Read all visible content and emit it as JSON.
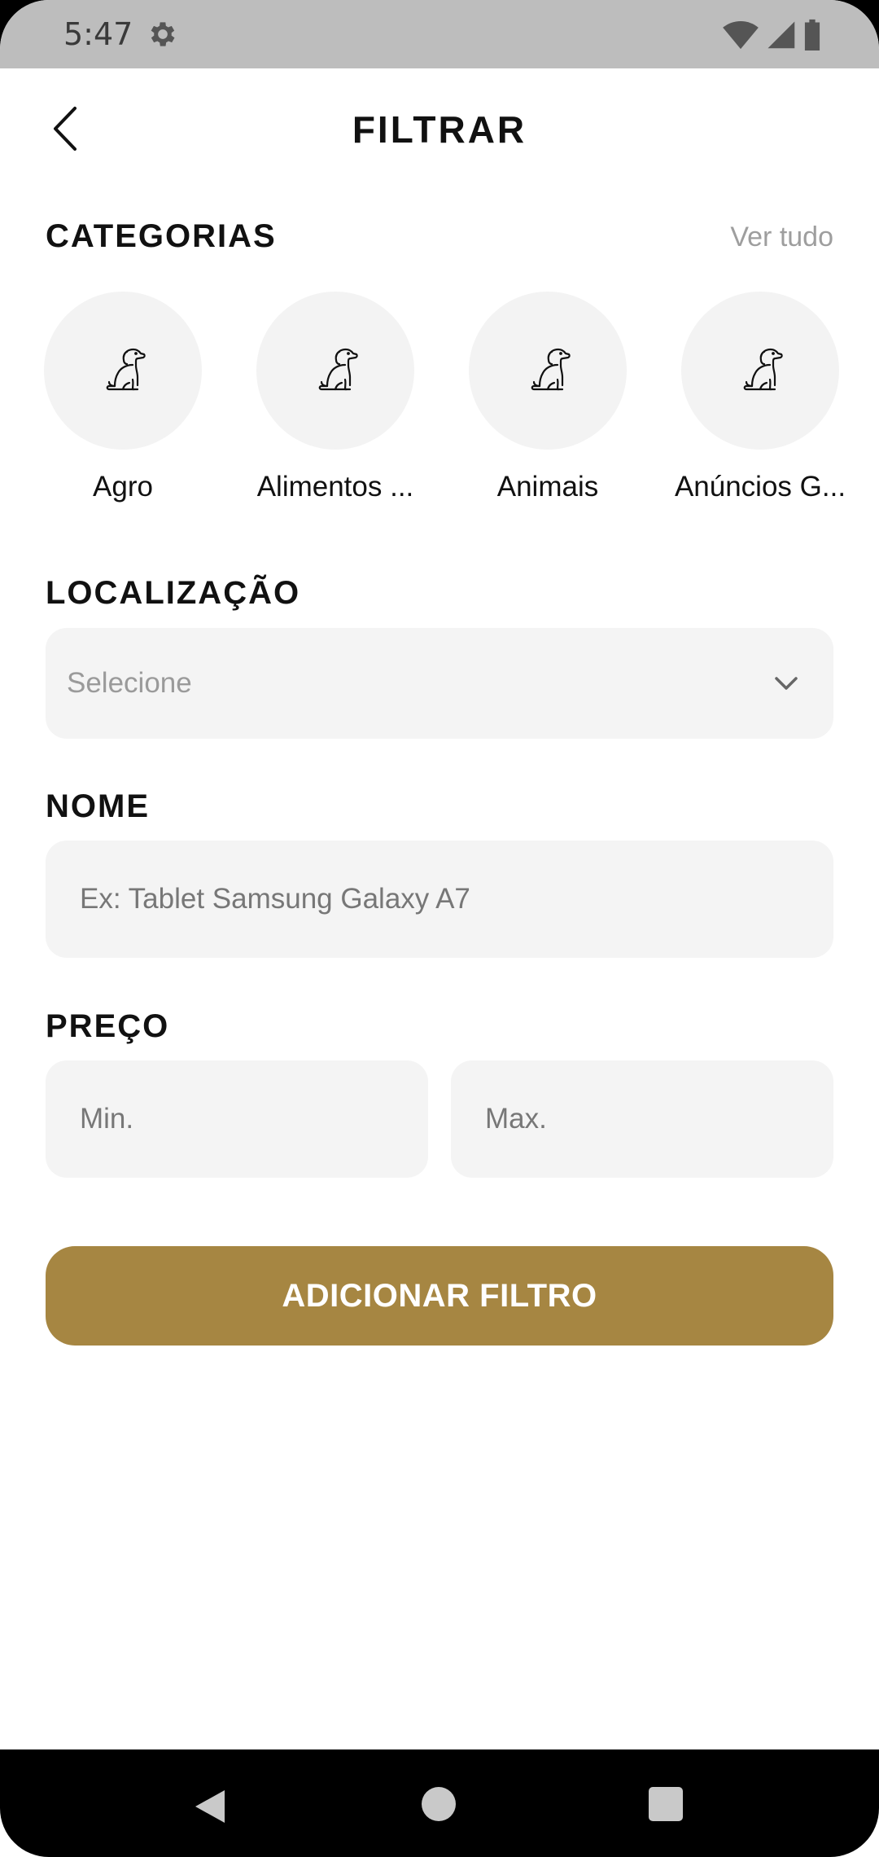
{
  "status_bar": {
    "time": "5:47",
    "icons": [
      "settings-icon",
      "wifi-icon",
      "signal-icon",
      "battery-icon"
    ]
  },
  "header": {
    "title": "FILTRAR",
    "back_icon": "chevron-left-icon"
  },
  "categories": {
    "title": "CATEGORIAS",
    "see_all": "Ver tudo",
    "items": [
      {
        "label": "Agro",
        "icon": "dog-icon"
      },
      {
        "label": "Alimentos ...",
        "icon": "dog-icon"
      },
      {
        "label": "Animais",
        "icon": "dog-icon"
      },
      {
        "label": "Anúncios G...",
        "icon": "dog-icon"
      }
    ]
  },
  "location": {
    "title": "LOCALIZAÇÃO",
    "placeholder": "Selecione",
    "icon": "chevron-down-icon"
  },
  "name": {
    "title": "NOME",
    "placeholder": "Ex: Tablet Samsung Galaxy A7"
  },
  "price": {
    "title": "PREÇO",
    "min_placeholder": "Min.",
    "max_placeholder": "Max."
  },
  "actions": {
    "submit_label": "ADICIONAR FILTRO"
  },
  "colors": {
    "accent": "#a68642",
    "field_bg": "#f4f4f4",
    "status_bar": "#bdbdbd"
  },
  "nav_bar": {
    "icons": [
      "back-triangle-icon",
      "home-circle-icon",
      "recents-square-icon"
    ]
  }
}
